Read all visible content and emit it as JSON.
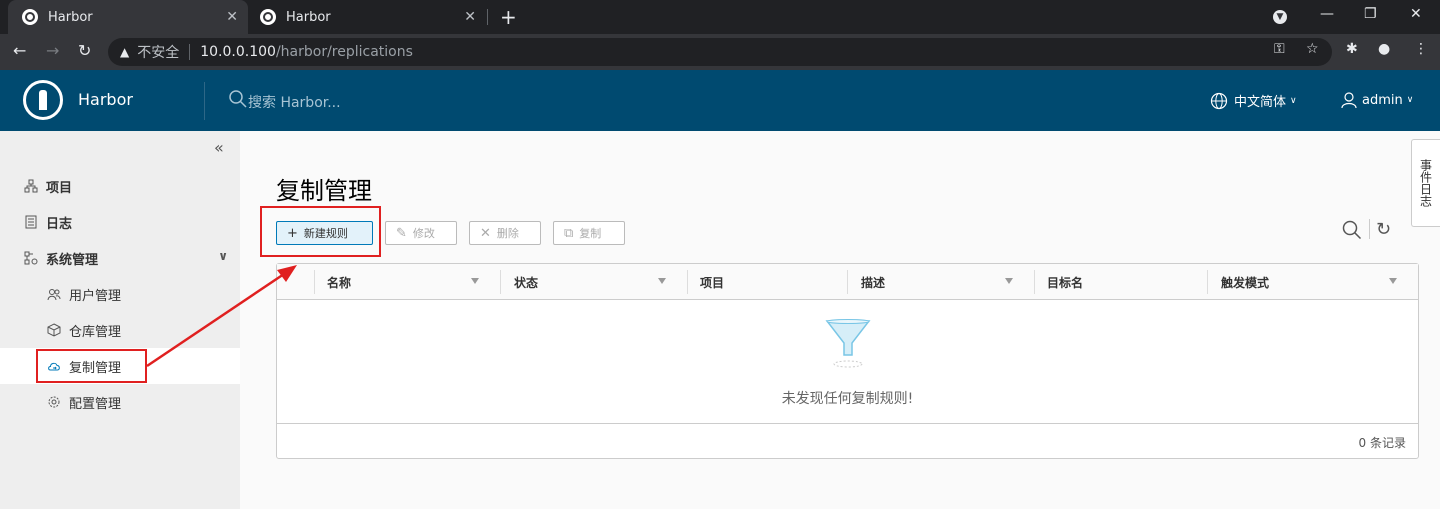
{
  "browser": {
    "tabs": [
      {
        "title": "Harbor",
        "active": true
      },
      {
        "title": "Harbor",
        "active": false
      }
    ],
    "address": {
      "security_label": "不安全",
      "host": "10.0.0.100",
      "path": "/harbor/replications"
    }
  },
  "header": {
    "app_name": "Harbor",
    "search_placeholder": "搜索 Harbor...",
    "language": "中文简体",
    "user": "admin"
  },
  "sidebar": {
    "items": [
      {
        "label": "项目",
        "icon": "projects-icon"
      },
      {
        "label": "日志",
        "icon": "logs-icon"
      },
      {
        "label": "系统管理",
        "icon": "admin-icon"
      },
      {
        "label": "用户管理",
        "icon": "users-icon"
      },
      {
        "label": "仓库管理",
        "icon": "registry-icon"
      },
      {
        "label": "复制管理",
        "icon": "cloud-replication-icon",
        "active": true
      },
      {
        "label": "配置管理",
        "icon": "gear-icon"
      }
    ]
  },
  "main": {
    "title": "复制管理",
    "buttons": {
      "new_rule": "新建规则",
      "edit": "修改",
      "delete": "删除",
      "copy": "复制"
    },
    "table": {
      "columns": [
        "名称",
        "状态",
        "项目",
        "描述",
        "目标名",
        "触发模式"
      ],
      "empty_text": "未发现任何复制规则!",
      "footer": "0 条记录"
    }
  },
  "event_log_tab": "事件日志",
  "colors": {
    "header_bg": "#004a70",
    "primary": "#0079b8",
    "annotation": "#e02020"
  }
}
